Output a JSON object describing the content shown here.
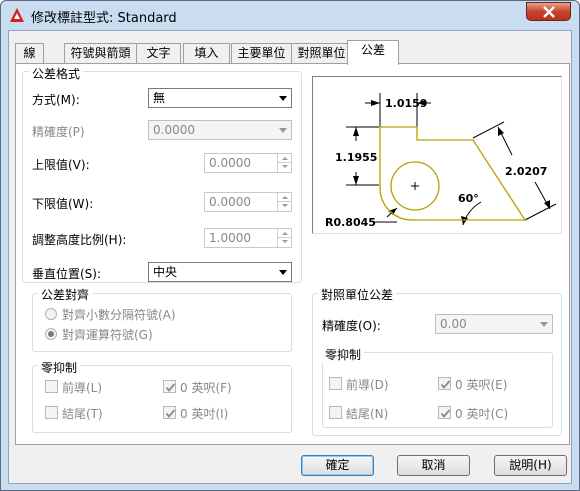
{
  "window": {
    "title": "修改標註型式: Standard"
  },
  "tabs": [
    {
      "label": "線"
    },
    {
      "label": "符號與箭頭"
    },
    {
      "label": "文字"
    },
    {
      "label": "填入"
    },
    {
      "label": "主要單位"
    },
    {
      "label": "對照單位"
    },
    {
      "label": "公差"
    }
  ],
  "tolerance_format": {
    "legend": "公差格式",
    "method_label": "方式(M):",
    "method_value": "無",
    "precision_label": "精確度(P)",
    "precision_value": "0.0000",
    "upper_label": "上限值(V):",
    "upper_value": "0.0000",
    "lower_label": "下限值(W):",
    "lower_value": "0.0000",
    "scale_label": "調整高度比例(H):",
    "scale_value": "1.0000",
    "vpos_label": "垂直位置(S):",
    "vpos_value": "中央"
  },
  "alignment": {
    "legend": "公差對齊",
    "option1": "對齊小數分隔符號(A)",
    "option2": "對齊運算符號(G)"
  },
  "zero_suppression": {
    "legend": "零抑制",
    "leading": "前導(L)",
    "trailing": "結尾(T)",
    "feet": "0 英呎(F)",
    "inches": "0 英吋(I)"
  },
  "alt_tolerance": {
    "legend": "對照單位公差",
    "precision_label": "精確度(O):",
    "precision_value": "0.00",
    "zero_legend": "零抑制",
    "leading": "前導(D)",
    "trailing": "結尾(N)",
    "feet": "0 英呎(E)",
    "inches": "0 英吋(C)"
  },
  "preview": {
    "dim_top": "1.0159",
    "dim_left": "1.1955",
    "dim_right": "2.0207",
    "angle": "60°",
    "radius": "R0.8045"
  },
  "buttons": {
    "ok": "確定",
    "cancel": "取消",
    "help": "說明(H)"
  },
  "colors": {
    "shape": "#b8a000",
    "accent": "#3c7fb1"
  }
}
